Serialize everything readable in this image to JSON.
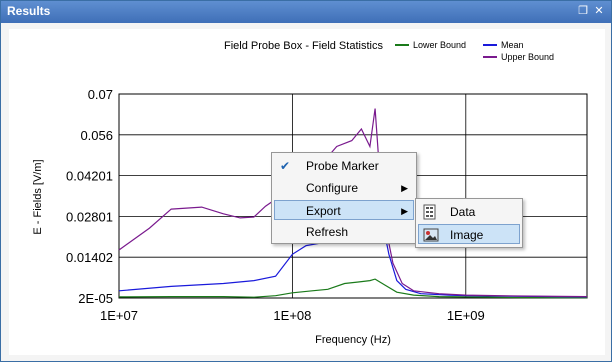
{
  "window": {
    "title": "Results",
    "restore_icon": "restore-icon",
    "close_icon": "close-icon"
  },
  "chart_data": {
    "type": "line",
    "title": "Field Probe Box - Field Statistics",
    "xlabel": "Frequency (Hz)",
    "ylabel": "E - Fields [V/m]",
    "x_scale": "log",
    "xlim": [
      10000000,
      5000000000
    ],
    "ylim": [
      2e-05,
      0.07
    ],
    "x_ticks": [
      "1E+07",
      "1E+08",
      "1E+09"
    ],
    "y_ticks": [
      "0.07",
      "0.056",
      "0.04201",
      "0.02801",
      "0.01402",
      "2E-05"
    ],
    "grid": true,
    "legend_placement": "top-right",
    "series": [
      {
        "name": "Lower Bound",
        "color": "#1a7a1a",
        "x": [
          10000000,
          20000000,
          40000000,
          60000000,
          80000000,
          100000000,
          130000000,
          160000000,
          200000000,
          240000000,
          280000000,
          300000000,
          340000000,
          400000000,
          500000000,
          700000000,
          1000000000,
          2000000000,
          5000000000
        ],
        "y": [
          0.0004,
          0.0005,
          0.0005,
          0.0003,
          0.0008,
          0.0018,
          0.0025,
          0.003,
          0.005,
          0.0055,
          0.006,
          0.0065,
          0.0045,
          0.002,
          0.001,
          0.0005,
          0.0004,
          0.0002,
          0.0001
        ]
      },
      {
        "name": "Mean",
        "color": "#1a1adb",
        "x": [
          10000000,
          20000000,
          40000000,
          60000000,
          80000000,
          100000000,
          120000000,
          150000000,
          180000000,
          220000000,
          260000000,
          290000000,
          320000000,
          360000000,
          400000000,
          450000000,
          550000000,
          800000000,
          1000000000,
          2000000000,
          5000000000
        ],
        "y": [
          0.0025,
          0.004,
          0.005,
          0.006,
          0.0075,
          0.015,
          0.018,
          0.019,
          0.021,
          0.027,
          0.031,
          0.039,
          0.03,
          0.015,
          0.006,
          0.003,
          0.0015,
          0.001,
          0.0008,
          0.0006,
          0.0004
        ]
      },
      {
        "name": "Upper Bound",
        "color": "#7a1a8e",
        "x": [
          10000000,
          15000000,
          20000000,
          30000000,
          40000000,
          50000000,
          60000000,
          70000000,
          90000000,
          120000000,
          150000000,
          180000000,
          220000000,
          250000000,
          280000000,
          300000000,
          330000000,
          380000000,
          430000000,
          500000000,
          700000000,
          1000000000,
          2000000000,
          5000000000
        ],
        "y": [
          0.0165,
          0.024,
          0.0305,
          0.0312,
          0.0289,
          0.0275,
          0.0278,
          0.0315,
          0.036,
          0.042,
          0.0465,
          0.052,
          0.054,
          0.058,
          0.052,
          0.065,
          0.03,
          0.012,
          0.005,
          0.0025,
          0.0015,
          0.001,
          0.0007,
          0.0005
        ]
      }
    ]
  },
  "context_menu": {
    "items": [
      {
        "label": "Probe Marker",
        "checked": true
      },
      {
        "label": "Configure",
        "submenu": true
      },
      {
        "label": "Export",
        "submenu": true,
        "highlighted": true
      },
      {
        "label": "Refresh"
      }
    ],
    "submenu_arrow": "▶"
  },
  "export_submenu": {
    "items": [
      {
        "label": "Data",
        "icon": "data-table-icon"
      },
      {
        "label": "Image",
        "icon": "image-icon",
        "highlighted": true
      }
    ]
  }
}
